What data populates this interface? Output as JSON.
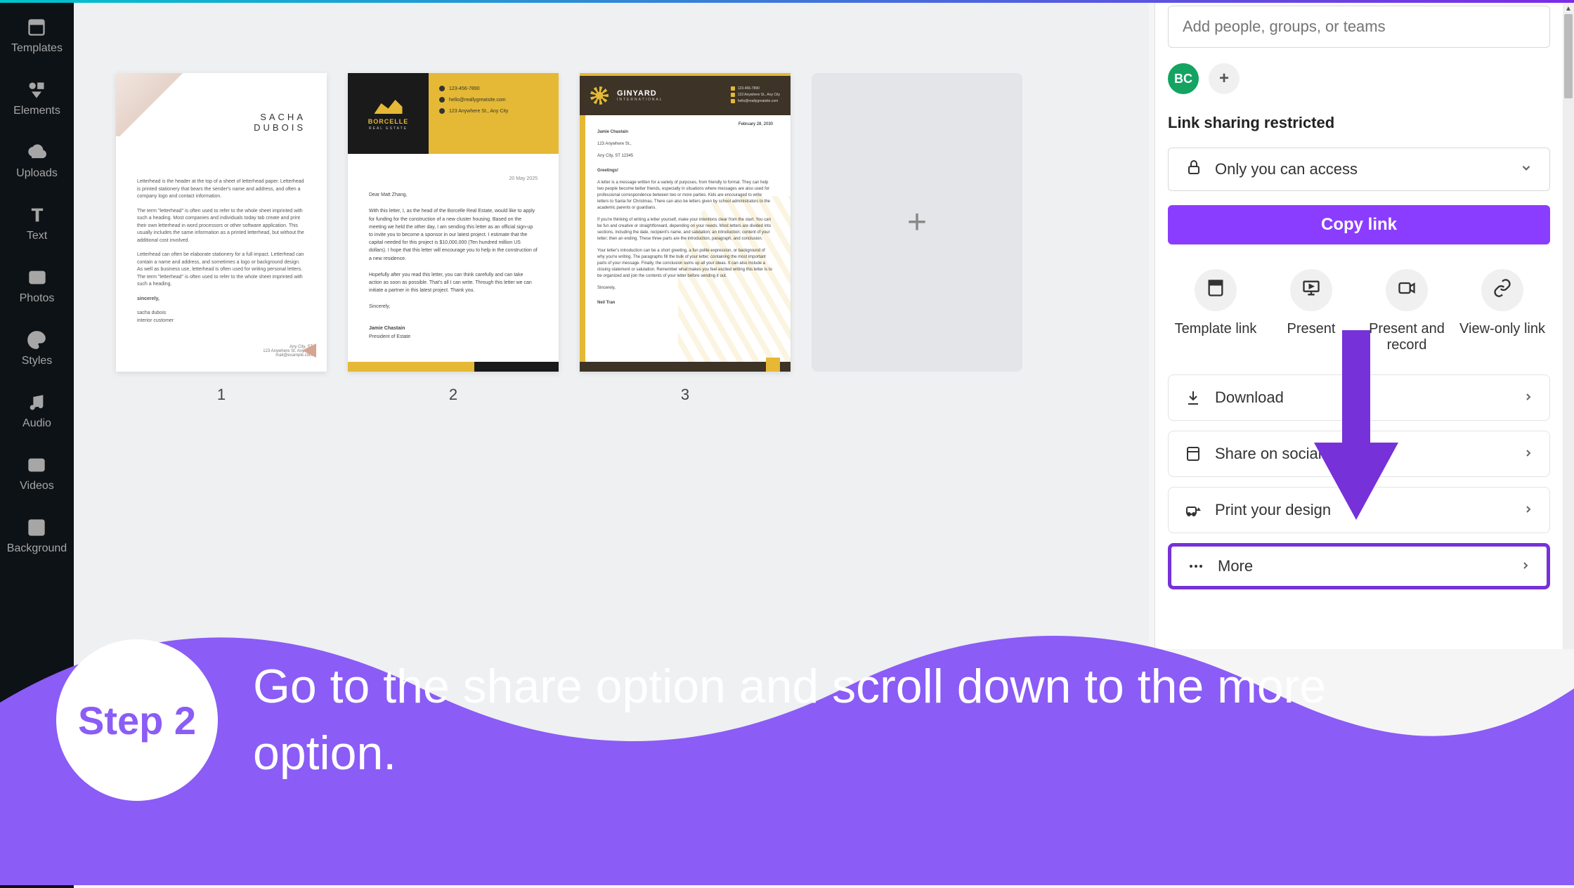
{
  "sidebar": {
    "items": [
      {
        "label": "Templates"
      },
      {
        "label": "Elements"
      },
      {
        "label": "Uploads"
      },
      {
        "label": "Text"
      },
      {
        "label": "Photos"
      },
      {
        "label": "Styles"
      },
      {
        "label": "Audio"
      },
      {
        "label": "Videos"
      },
      {
        "label": "Background"
      }
    ]
  },
  "pages": {
    "p1": {
      "num": "1",
      "name_first": "SACHA",
      "name_last": "DUBOIS"
    },
    "p2": {
      "num": "2",
      "logo": "BORCELLE",
      "logo_sub": "REAL ESTATE",
      "date": "20 May 2025",
      "greeting": "Dear Matt Zhang,",
      "sig_name": "Jamie Chastain",
      "sig_title": "President of Estate",
      "closing": "Sincerely,"
    },
    "p3": {
      "num": "3",
      "logo": "GINYARD",
      "logo_sub": "INTERNATIONAL",
      "date": "February 28, 2030",
      "addr_name": "Jamie Chastain",
      "addr1": "123 Anywhere St.,",
      "addr2": "Any City, ST 12345",
      "greeting": "Greetings!",
      "closing": "Sincerely,",
      "sig": "Neil Tran"
    }
  },
  "share": {
    "placeholder": "Add people, groups, or teams",
    "avatar_initials": "BC",
    "link_label": "Link sharing restricted",
    "access_text": "Only you can access",
    "copy_btn": "Copy link",
    "grid": [
      {
        "label": "Template link"
      },
      {
        "label": "Present"
      },
      {
        "label": "Present and record"
      },
      {
        "label": "View-only link"
      }
    ],
    "rows": [
      {
        "label": "Download"
      },
      {
        "label": "Share on social"
      },
      {
        "label": "Print your design"
      },
      {
        "label": "More"
      }
    ]
  },
  "step": {
    "badge": "Step 2",
    "text": "Go to the share option and scroll down to the more option."
  }
}
